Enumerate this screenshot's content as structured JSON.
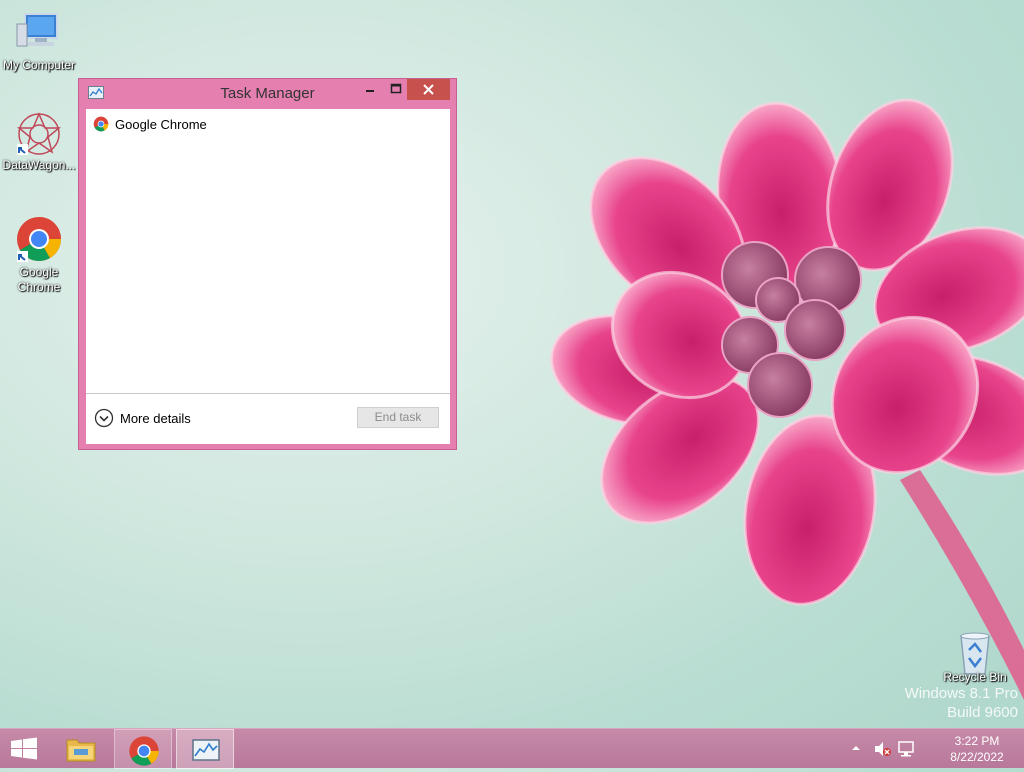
{
  "desktop": {
    "icons": [
      {
        "label": "My Computer",
        "icon": "computer-icon"
      },
      {
        "label": "DataWagon...",
        "icon": "datawagon-icon"
      },
      {
        "label": "Google Chrome",
        "icon": "chrome-icon"
      },
      {
        "label": "Recycle Bin",
        "icon": "recycle-bin-icon"
      }
    ],
    "watermark_line1": "Windows 8.1 Pro",
    "watermark_line2": "Build 9600"
  },
  "task_manager": {
    "title": "Task Manager",
    "process": {
      "name": "Google Chrome",
      "icon": "chrome-icon"
    },
    "more_details_label": "More details",
    "end_task_label": "End task"
  },
  "taskbar": {
    "items": [
      "start-button",
      "file-explorer-icon",
      "chrome-icon",
      "task-manager-icon"
    ],
    "clock_time": "3:22 PM",
    "clock_date": "8/22/2022"
  },
  "colors": {
    "window_frame": "#e57fb0",
    "close_button": "#c7514c",
    "taskbar": "#c78aa8"
  }
}
